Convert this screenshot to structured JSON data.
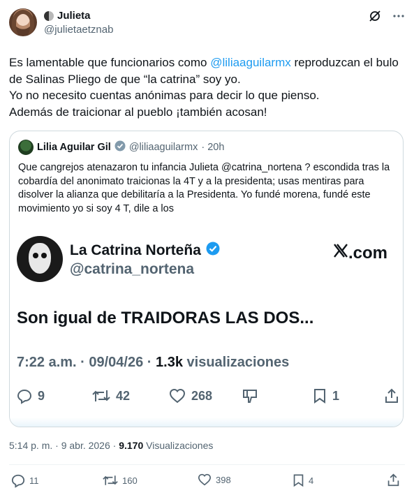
{
  "author": {
    "name": "Julieta",
    "handle": "@julietaetznab"
  },
  "tweet": {
    "text_before_mention": "Es lamentable que funcionarios como ",
    "mention": "@liliaaguilarmx",
    "text_after_mention": " reproduzcan el bulo de Salinas Pliego de que “la catrina” soy yo.",
    "line2": "Yo no necesito cuentas anónimas para decir lo que pienso.",
    "line3": "Además de traicionar al pueblo ¡también acosan!"
  },
  "quote": {
    "name": "Lilia Aguilar Gil",
    "handle": "@liliaaguilarmx",
    "time": "· 20h",
    "text": "Que cangrejos atenazaron tu infancia Julieta @catrina_nortena ? escondida tras la cobardía del anonimato traicionas la 4T y a la presidenta; usas mentiras para disolver la alianza que debilitaría a la Presidenta. Yo fundé morena, fundé este movimiento yo si soy 4 T, dile a los"
  },
  "embedded": {
    "name": "La Catrina Norteña",
    "handle": "@catrina_nortena",
    "brand": ".com",
    "text": "Son igual de TRAIDORAS LAS DOS...",
    "meta_time": "7:22 a.m. · 09/04/26 · ",
    "meta_views_count": "1.3k",
    "meta_views_label": " visualizaciones",
    "replies": "9",
    "reposts": "42",
    "likes": "268",
    "bookmarks": "1"
  },
  "timestamp": {
    "time": "5:14 p. m. · 9 abr. 2026 · ",
    "views_count": "9.170",
    "views_label": " Visualizaciones"
  },
  "actions": {
    "replies": "11",
    "reposts": "160",
    "likes": "398",
    "bookmarks": "4"
  },
  "colors": {
    "accent": "#1d9bf0",
    "secondary_text": "#536471",
    "border": "#cfd9de"
  }
}
